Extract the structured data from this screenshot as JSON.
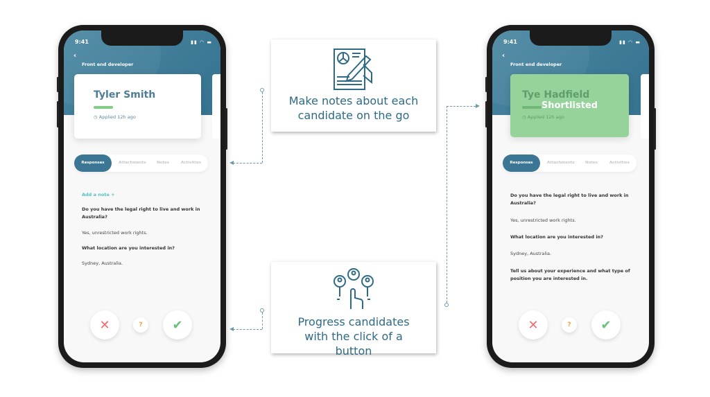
{
  "phones": [
    {
      "time": "9:41",
      "job_title": "Front end developer",
      "candidate": "Tyler Smith",
      "applied": "Applied 12h ago",
      "tabs": [
        "Responses",
        "Attachments",
        "Notes",
        "Activities"
      ],
      "add_note": "Add a note +",
      "qa": [
        {
          "q": "Do you have the legal right to live and work in Australia?",
          "a": "Yes, unrestricted work rights."
        },
        {
          "q": "What location are you interested in?",
          "a": "Sydney, Australia."
        }
      ]
    },
    {
      "time": "9:41",
      "job_title": "Front end developer",
      "candidate": "Tye Hadfield",
      "applied": "Applied 12h ago",
      "overlay": "Shortlisted",
      "tabs": [
        "Responses",
        "Attachments",
        "Notes",
        "Activities"
      ],
      "qa": [
        {
          "q": "Do you have the legal right to live and work in Australia?",
          "a": "Yes, unrestricted work rights."
        },
        {
          "q": "What location are you interested in?",
          "a": "Sydney, Australia."
        },
        {
          "q": "Tell us about your experience and what type of position you are interested in.",
          "a": ""
        }
      ]
    }
  ],
  "actions": {
    "reject": "✕",
    "maybe": "?",
    "accept": "✔"
  },
  "callouts": [
    {
      "icon": "document-pen-icon",
      "text": "Make notes about each candidate on the go"
    },
    {
      "icon": "candidates-click-icon",
      "text": "Progress candidates with the click of a button"
    }
  ],
  "colors": {
    "brand": "#3b7794",
    "accent_green": "#7fcf84",
    "reject": "#ef6b6b",
    "maybe": "#f3a23a"
  }
}
